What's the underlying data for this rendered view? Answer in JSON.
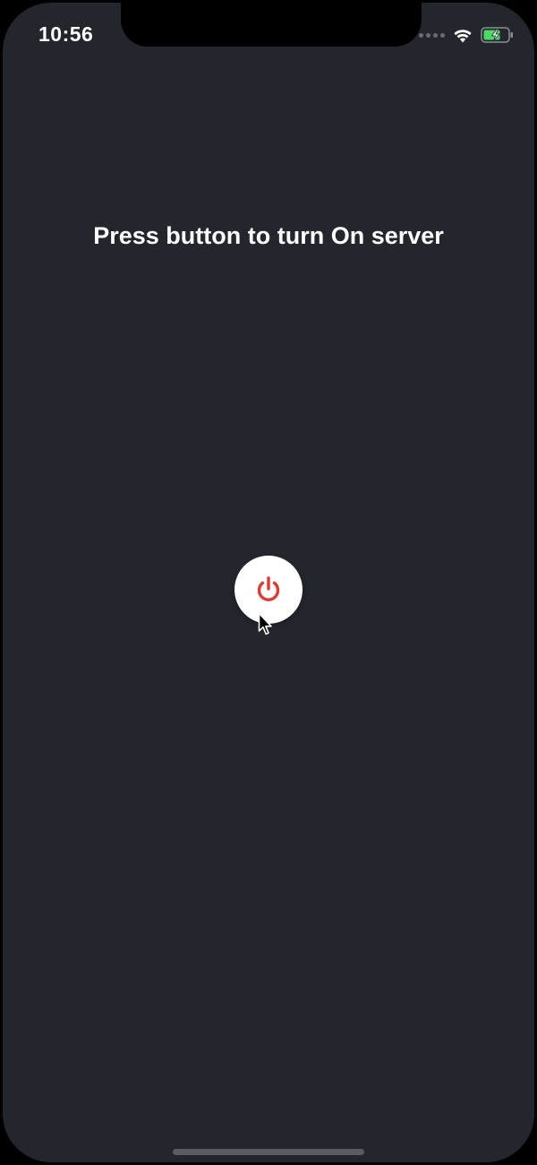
{
  "status_bar": {
    "time": "10:56",
    "signal_icon": "signal-dots-icon",
    "wifi_icon": "wifi-icon",
    "battery_icon": "battery-charging-icon"
  },
  "main": {
    "title": "Press button to turn On server",
    "power_button_icon": "power-icon"
  },
  "colors": {
    "background": "#24262e",
    "text": "#ffffff",
    "button_background": "#ffffff",
    "power_icon": "#e5392f",
    "battery_fill": "#4cd964"
  }
}
